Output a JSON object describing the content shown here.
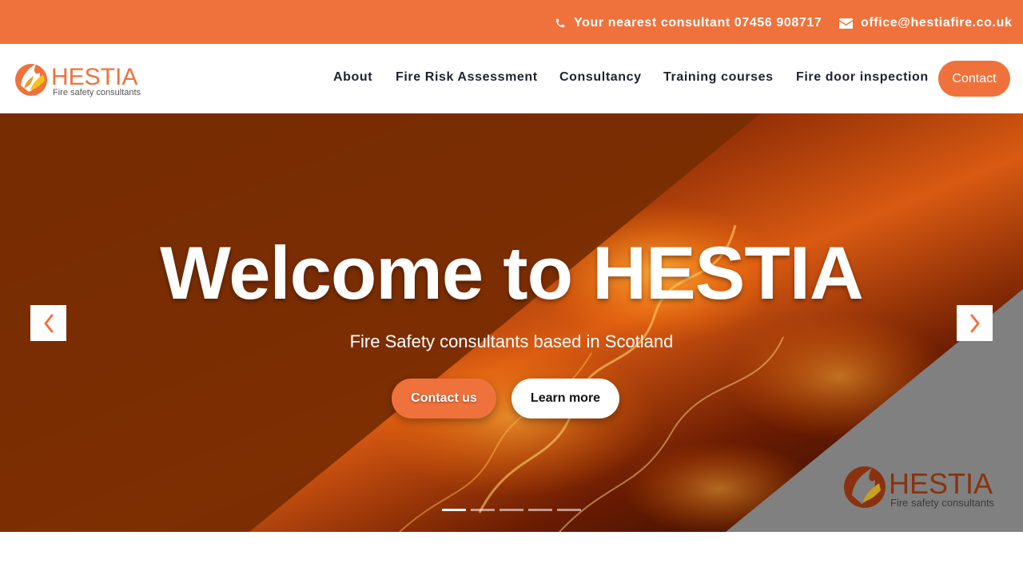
{
  "topbar": {
    "phone_text": "Your nearest consultant 07456 908717",
    "email_text": "office@hestiafire.co.uk"
  },
  "brand": {
    "name": "HESTIA",
    "tagline": "Fire safety consultants",
    "accent_color": "#ef723c"
  },
  "nav": {
    "items": [
      {
        "label": "About"
      },
      {
        "label": "Fire Risk Assessment"
      },
      {
        "label": "Consultancy"
      },
      {
        "label": "Training courses"
      },
      {
        "label": "Fire door inspection"
      }
    ],
    "contact_label": "Contact"
  },
  "hero": {
    "title": "Welcome to HESTIA",
    "subtitle": "Fire Safety consultants based in Scotland",
    "primary_cta": "Contact us",
    "secondary_cta": "Learn more",
    "slide_count": 5,
    "active_slide": 1,
    "prev_icon": "chevron-left-icon",
    "next_icon": "chevron-right-icon"
  },
  "icons": {
    "phone": "phone-icon",
    "email": "envelope-icon"
  }
}
